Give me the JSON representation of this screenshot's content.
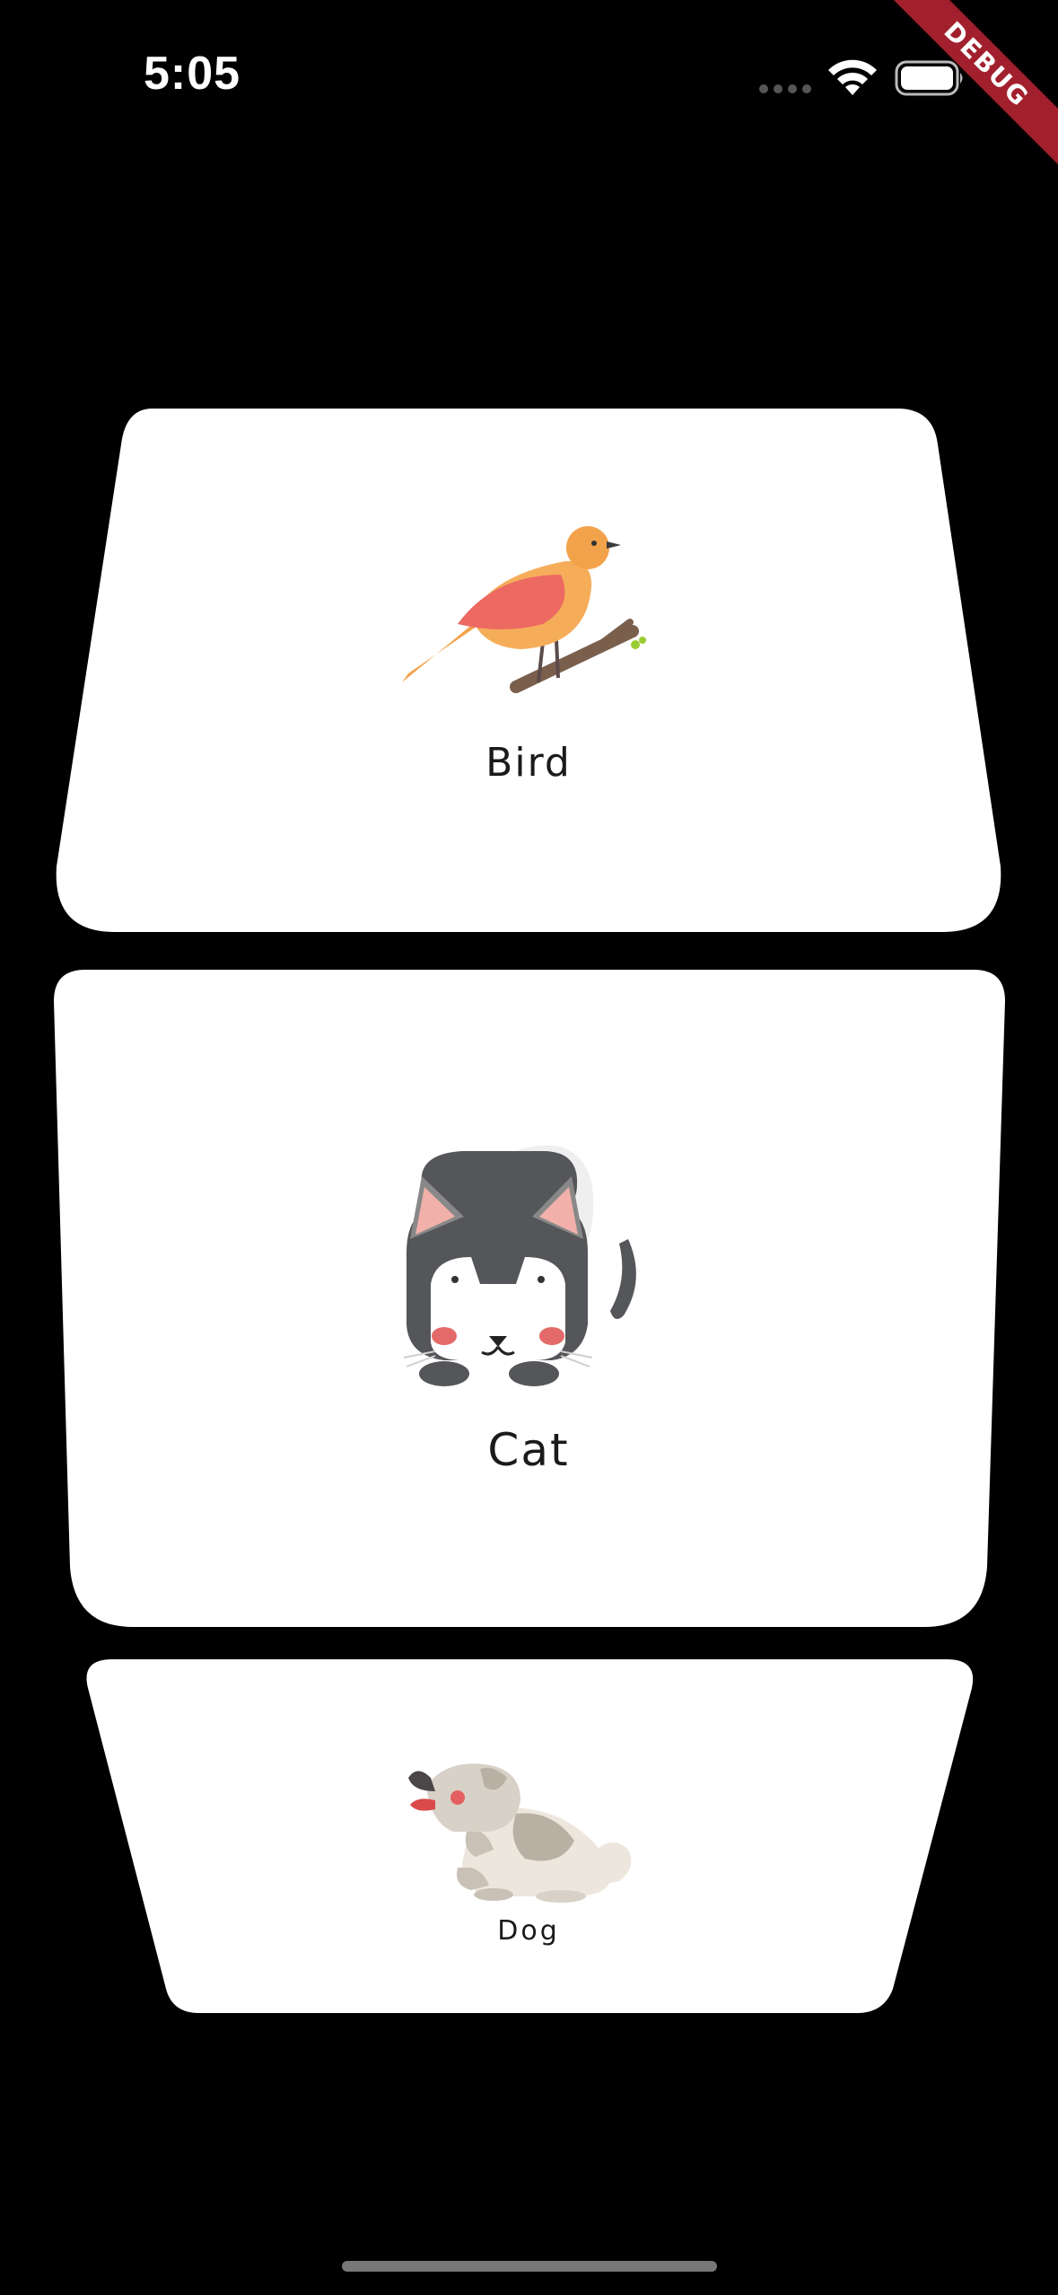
{
  "status_bar": {
    "time": "5:05",
    "wifi_icon": "wifi-icon",
    "battery_icon": "battery-icon"
  },
  "debug_banner": "DEBUG",
  "cards": [
    {
      "label": "Bird",
      "icon": "bird-icon"
    },
    {
      "label": "Cat",
      "icon": "cat-icon"
    },
    {
      "label": "Dog",
      "icon": "dog-icon"
    }
  ],
  "colors": {
    "background": "#000000",
    "card": "#ffffff",
    "debug_ribbon": "#a2202d"
  }
}
